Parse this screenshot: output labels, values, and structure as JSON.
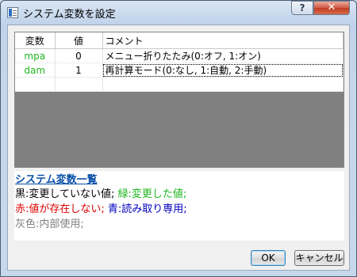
{
  "window": {
    "title": "システム変数を設定",
    "help_label": "?",
    "close_label": "✕"
  },
  "grid": {
    "columns": [
      "変数",
      "値",
      "コメント"
    ],
    "rows": [
      {
        "variable": "mpa",
        "value": "0",
        "comment": "メニュー折りたたみ(0:オフ, 1:オン)",
        "color": "#1fb41f"
      },
      {
        "variable": "dam",
        "value": "1",
        "comment": "再計算モード(0:なし, 1:自動, 2:手動)",
        "color": "#1fb41f"
      }
    ]
  },
  "legend": {
    "title": "システム変数一覧",
    "black": "黒:変更していない値;",
    "green": "緑:変更した値;",
    "red": "赤:値が存在しない;",
    "blue": "青:読み取り専用;",
    "gray": "灰色:内部使用;",
    "colors": {
      "black": "#000000",
      "green": "#1fb41f",
      "red": "#e00000",
      "blue": "#0000c0",
      "gray": "#808080"
    }
  },
  "buttons": {
    "ok": "OK",
    "cancel": "キャンセル"
  }
}
